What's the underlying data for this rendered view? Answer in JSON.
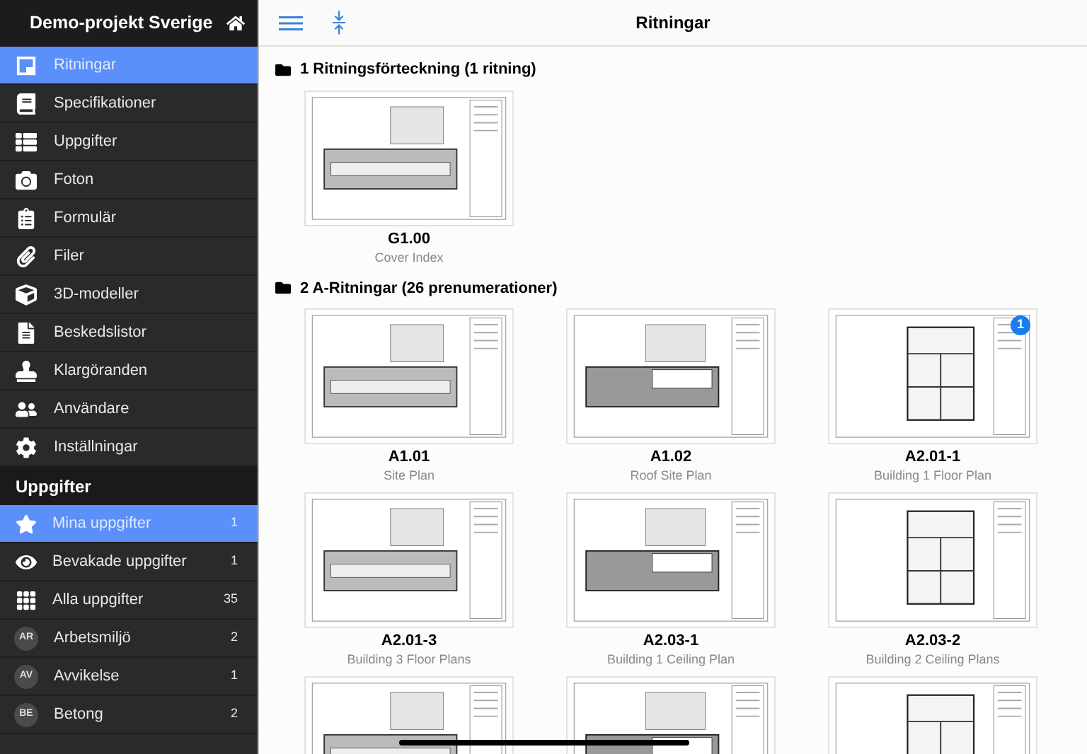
{
  "sidebar": {
    "title": "Demo-projekt Sverige",
    "nav": [
      {
        "label": "Ritningar",
        "selected": true
      },
      {
        "label": "Specifikationer",
        "selected": false
      },
      {
        "label": "Uppgifter",
        "selected": false
      },
      {
        "label": "Foton",
        "selected": false
      },
      {
        "label": "Formulär",
        "selected": false
      },
      {
        "label": "Filer",
        "selected": false
      },
      {
        "label": "3D-modeller",
        "selected": false
      },
      {
        "label": "Beskedslistor",
        "selected": false
      },
      {
        "label": "Klargöranden",
        "selected": false
      },
      {
        "label": "Användare",
        "selected": false
      },
      {
        "label": "Inställningar",
        "selected": false
      }
    ],
    "section_title": "Uppgifter",
    "tasks": [
      {
        "kind": "icon",
        "label": "Mina uppgifter",
        "count": "1",
        "selected": true
      },
      {
        "kind": "icon",
        "label": "Bevakade uppgifter",
        "count": "1",
        "selected": false
      },
      {
        "kind": "icon",
        "label": "Alla uppgifter",
        "count": "35",
        "selected": false
      },
      {
        "kind": "avatar",
        "initials": "AR",
        "label": "Arbetsmiljö",
        "count": "2",
        "selected": false
      },
      {
        "kind": "avatar",
        "initials": "AV",
        "label": "Avvikelse",
        "count": "1",
        "selected": false
      },
      {
        "kind": "avatar",
        "initials": "BE",
        "label": "Betong",
        "count": "2",
        "selected": false
      }
    ]
  },
  "header": {
    "title": "Ritningar"
  },
  "folders": [
    {
      "title": "1 Ritningsförteckning (1 ritning)",
      "drawings": [
        {
          "kind": "sheet",
          "code": "G1.00",
          "name": "Cover Index"
        }
      ]
    },
    {
      "title": "2 A-Ritningar (26 prenumerationer)",
      "drawings": [
        {
          "kind": "sheet",
          "code": "A1.01",
          "name": "Site Plan"
        },
        {
          "kind": "sheet",
          "code": "A1.02",
          "name": "Roof Site Plan"
        },
        {
          "kind": "sheet",
          "code": "A2.01-1",
          "name": "Building 1 Floor Plan",
          "badge": "1"
        },
        {
          "kind": "sheet",
          "code": "A2.01-3",
          "name": "Building 3 Floor Plans"
        },
        {
          "kind": "sheet",
          "code": "A2.03-1",
          "name": "Building 1 Ceiling Plan"
        },
        {
          "kind": "sheet",
          "code": "A2.03-2",
          "name": "Building 2 Ceiling Plans"
        },
        {
          "kind": "cut_off"
        },
        {
          "kind": "cut_off"
        },
        {
          "kind": "cut_off"
        }
      ]
    }
  ]
}
